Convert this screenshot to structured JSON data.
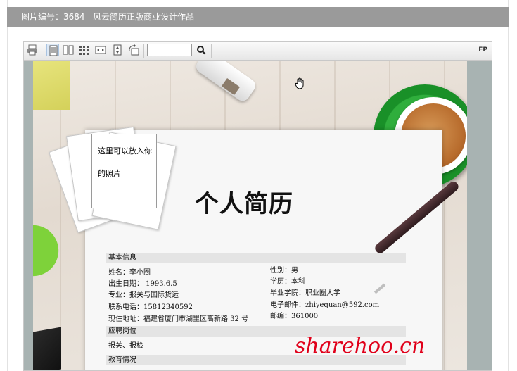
{
  "header": {
    "image_id": "图片编号：3684",
    "title": "风云简历正版商业设计作品"
  },
  "toolbar": {
    "icons": [
      "print-icon",
      "single-page-icon",
      "two-page-icon",
      "thumbnails-icon",
      "fit-width-icon",
      "fit-height-icon",
      "rotate-icon",
      "search-icon"
    ],
    "search_value": "",
    "brand": "FP"
  },
  "resume": {
    "photo_line1": "这里可以放入你",
    "photo_line2": "的照片",
    "title": "个人简历",
    "sections": {
      "basic": "基本信息",
      "position": "应聘岗位",
      "education": "教育情况"
    },
    "basic_left": [
      "姓名：李小圈",
      "出生日期：  1993.6.5",
      "专业：报关与国际货运",
      "联系电话：15812340592",
      "现住地址：福建省厦门市湖里区高新路 32 号"
    ],
    "basic_right": [
      "性别：男",
      "学历：本科",
      "毕业学院：职业圈大学",
      "电子邮件：zhiyequan@592.com",
      "邮编：361000"
    ],
    "position_value": "报关、报检"
  },
  "watermark": "sharehoo.cn",
  "colors": {
    "header_bg": "#9a9a9a",
    "mug_green": "#2fae3c",
    "watermark_red": "#e0001a"
  }
}
